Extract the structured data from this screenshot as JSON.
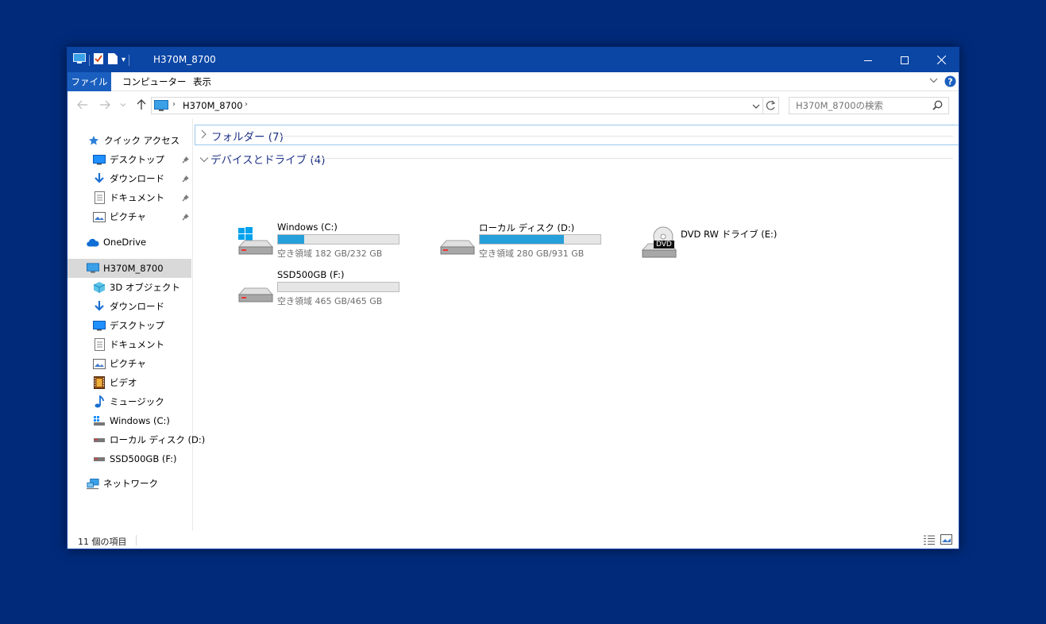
{
  "window": {
    "title": "H370M_8700",
    "quick_access_dropdown": "▾"
  },
  "ribbon": {
    "tabs": [
      {
        "label": "ファイル",
        "active": true
      },
      {
        "label": "コンピューター",
        "active": false
      },
      {
        "label": "表示",
        "active": false
      }
    ]
  },
  "address": {
    "path": "H370M_8700",
    "search_placeholder": "H370M_8700の検索"
  },
  "sidebar": {
    "quick_access": {
      "label": "クイック アクセス",
      "items": [
        {
          "label": "デスクトップ",
          "icon": "desktop-icon",
          "pinned": true
        },
        {
          "label": "ダウンロード",
          "icon": "download-icon",
          "pinned": true
        },
        {
          "label": "ドキュメント",
          "icon": "documents-icon",
          "pinned": true
        },
        {
          "label": "ピクチャ",
          "icon": "pictures-icon",
          "pinned": true
        }
      ]
    },
    "onedrive": {
      "label": "OneDrive",
      "icon": "onedrive-icon"
    },
    "this_pc": {
      "label": "H370M_8700",
      "icon": "computer-icon",
      "selected": true,
      "items": [
        {
          "label": "3D オブジェクト",
          "icon": "3d-objects-icon"
        },
        {
          "label": "ダウンロード",
          "icon": "download-icon"
        },
        {
          "label": "デスクトップ",
          "icon": "desktop-icon"
        },
        {
          "label": "ドキュメント",
          "icon": "documents-icon"
        },
        {
          "label": "ピクチャ",
          "icon": "pictures-icon"
        },
        {
          "label": "ビデオ",
          "icon": "videos-icon"
        },
        {
          "label": "ミュージック",
          "icon": "music-icon"
        },
        {
          "label": "Windows (C:)",
          "icon": "windows-drive-icon"
        },
        {
          "label": "ローカル ディスク (D:)",
          "icon": "drive-icon"
        },
        {
          "label": "SSD500GB (F:)",
          "icon": "drive-icon"
        }
      ]
    },
    "network": {
      "label": "ネットワーク",
      "icon": "network-icon"
    }
  },
  "content": {
    "folders_group": "フォルダー (7)",
    "devices_group": "デバイスとドライブ (4)",
    "drives": [
      {
        "name": "Windows (C:)",
        "info": "空き領域 182 GB/232 GB",
        "used_fraction": 0.216,
        "type": "windows"
      },
      {
        "name": "ローカル ディスク (D:)",
        "info": "空き領域 280 GB/931 GB",
        "used_fraction": 0.7,
        "type": "hdd"
      },
      {
        "name": "DVD RW ドライブ (E:)",
        "info": "",
        "type": "dvd",
        "dvd_label": "DVD"
      },
      {
        "name": "SSD500GB (F:)",
        "info": "空き領域 465 GB/465 GB",
        "used_fraction": 0.0,
        "type": "hdd"
      }
    ]
  },
  "status": {
    "item_count": "11 個の項目"
  },
  "colors": {
    "titlebar": "#0b46a5",
    "desktop": "#012a7a",
    "bar_fill": "#26a0da",
    "group_text": "#1e3287"
  }
}
